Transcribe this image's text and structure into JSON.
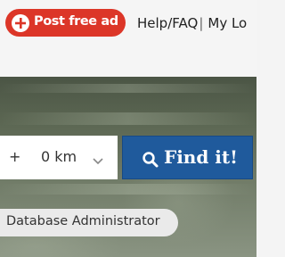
{
  "header": {
    "post_ad_label": "Post free ad",
    "help_label": "Help/FAQ",
    "separator": "|",
    "account_label": "My Lo"
  },
  "search": {
    "distance_prefix": "+",
    "distance_value": "0 km",
    "find_label": "Find it!"
  },
  "tags": [
    {
      "label": "Database Administrator"
    }
  ],
  "colors": {
    "post_ad_bg": "#dc3628",
    "find_button_bg": "#1f5a9c"
  }
}
